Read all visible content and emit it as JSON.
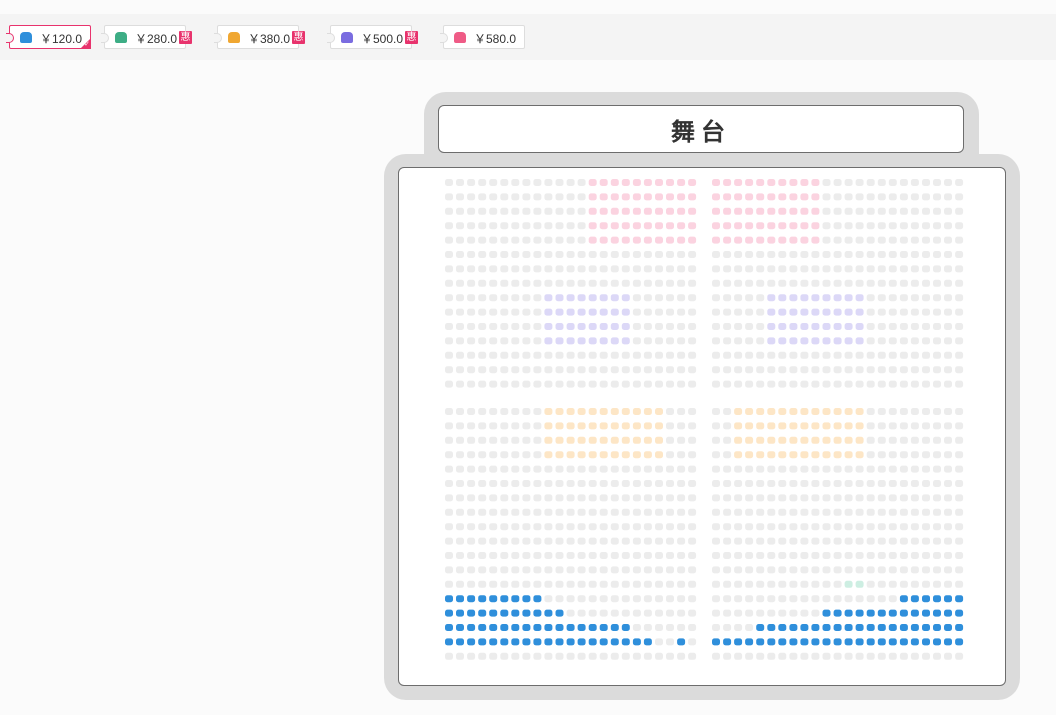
{
  "price_tabs": [
    {
      "price": "￥120.0",
      "color": "#2f8fdb",
      "selected": true,
      "flag": ""
    },
    {
      "price": "￥280.0",
      "color": "#3dad85",
      "selected": false,
      "flag": "惠"
    },
    {
      "price": "￥380.0",
      "color": "#f0a732",
      "selected": false,
      "flag": "惠"
    },
    {
      "price": "￥500.0",
      "color": "#7a6ce0",
      "selected": false,
      "flag": "惠"
    },
    {
      "price": "￥580.0",
      "color": "#ef5b86",
      "selected": false,
      "flag": ""
    }
  ],
  "stage": {
    "label": "舞台"
  },
  "seat_colors": {
    "sold": "#ececec",
    "tier_120": "#2f8fdb",
    "tier_280_dim": "#cdeee2",
    "tier_380_dim": "#fde6c6",
    "tier_500_dim": "#dcd8f7",
    "tier_580_dim": "#fbd3e0"
  }
}
